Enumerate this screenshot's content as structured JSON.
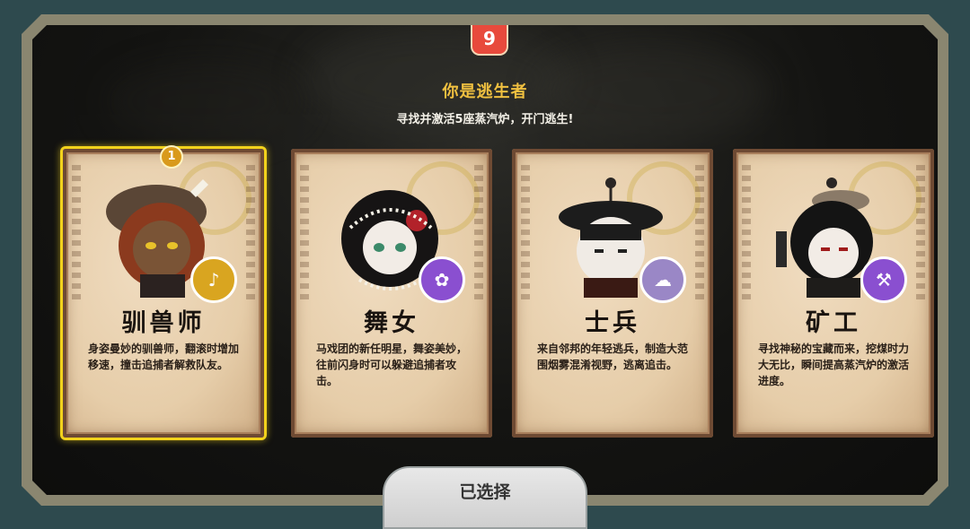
{
  "header": {
    "top_icon_glyph": "9",
    "title": "你是逃生者",
    "subtitle": "寻找并激活5座蒸汽炉，开门逃生!"
  },
  "cards": [
    {
      "name": "驯兽师",
      "desc": "身姿曼妙的驯兽师，翻滚时增加移速，撞击追捕者解救队友。",
      "selected": true,
      "number_badge": "1",
      "skill_icon": "horn-icon",
      "badge_color": "#d9a520",
      "hair_color": "#8b3a1e",
      "skin_color": "#7a5436"
    },
    {
      "name": "舞女",
      "desc": "马戏团的新任明星，舞姿美妙，往前闪身时可以躲避追捕者攻击。",
      "selected": false,
      "skill_icon": "dancer-icon",
      "badge_color": "#8a4fd0",
      "hair_color": "#161414",
      "skin_color": "#f2ece6"
    },
    {
      "name": "士兵",
      "desc": "来自邻邦的年轻逃兵，制造大范围烟雾混淆视野，逃离追击。",
      "selected": false,
      "skill_icon": "smoke-icon",
      "badge_color": "#9a87c6",
      "hair_color": "#1c1c1c",
      "skin_color": "#f0ebe5"
    },
    {
      "name": "矿工",
      "desc": "寻找神秘的宝藏而来，挖煤时力大无比，瞬间提高蒸汽炉的激活进度。",
      "selected": false,
      "skill_icon": "pickaxe-icon",
      "badge_color": "#8a4fd0",
      "hair_color": "#141414",
      "skin_color": "#f2ece6"
    }
  ],
  "footer": {
    "button_label": "已选择"
  }
}
